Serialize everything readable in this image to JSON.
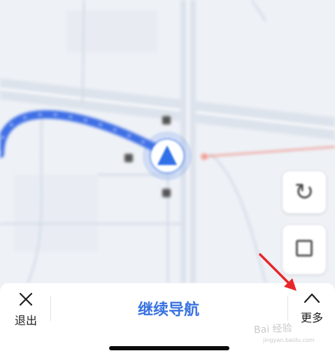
{
  "map": {
    "place_label_top": "",
    "road_label_vertical": "",
    "road_label_diagonal": "",
    "place_label_bottom_left": "",
    "place_label_bottom_mid": ""
  },
  "map_controls": {
    "rotate_icon": "rotate-icon",
    "layers_icon": "layers-icon",
    "layers_label": ""
  },
  "bottom_bar": {
    "exit_label": "退出",
    "continue_label": "继续导航",
    "more_label": "更多"
  },
  "watermark": {
    "text": "Bai 经验",
    "sub": "jingyan.baidu.com"
  },
  "colors": {
    "route": "#3f6fe6",
    "accent": "#3a72e0",
    "annotation_arrow": "#e8262a"
  }
}
